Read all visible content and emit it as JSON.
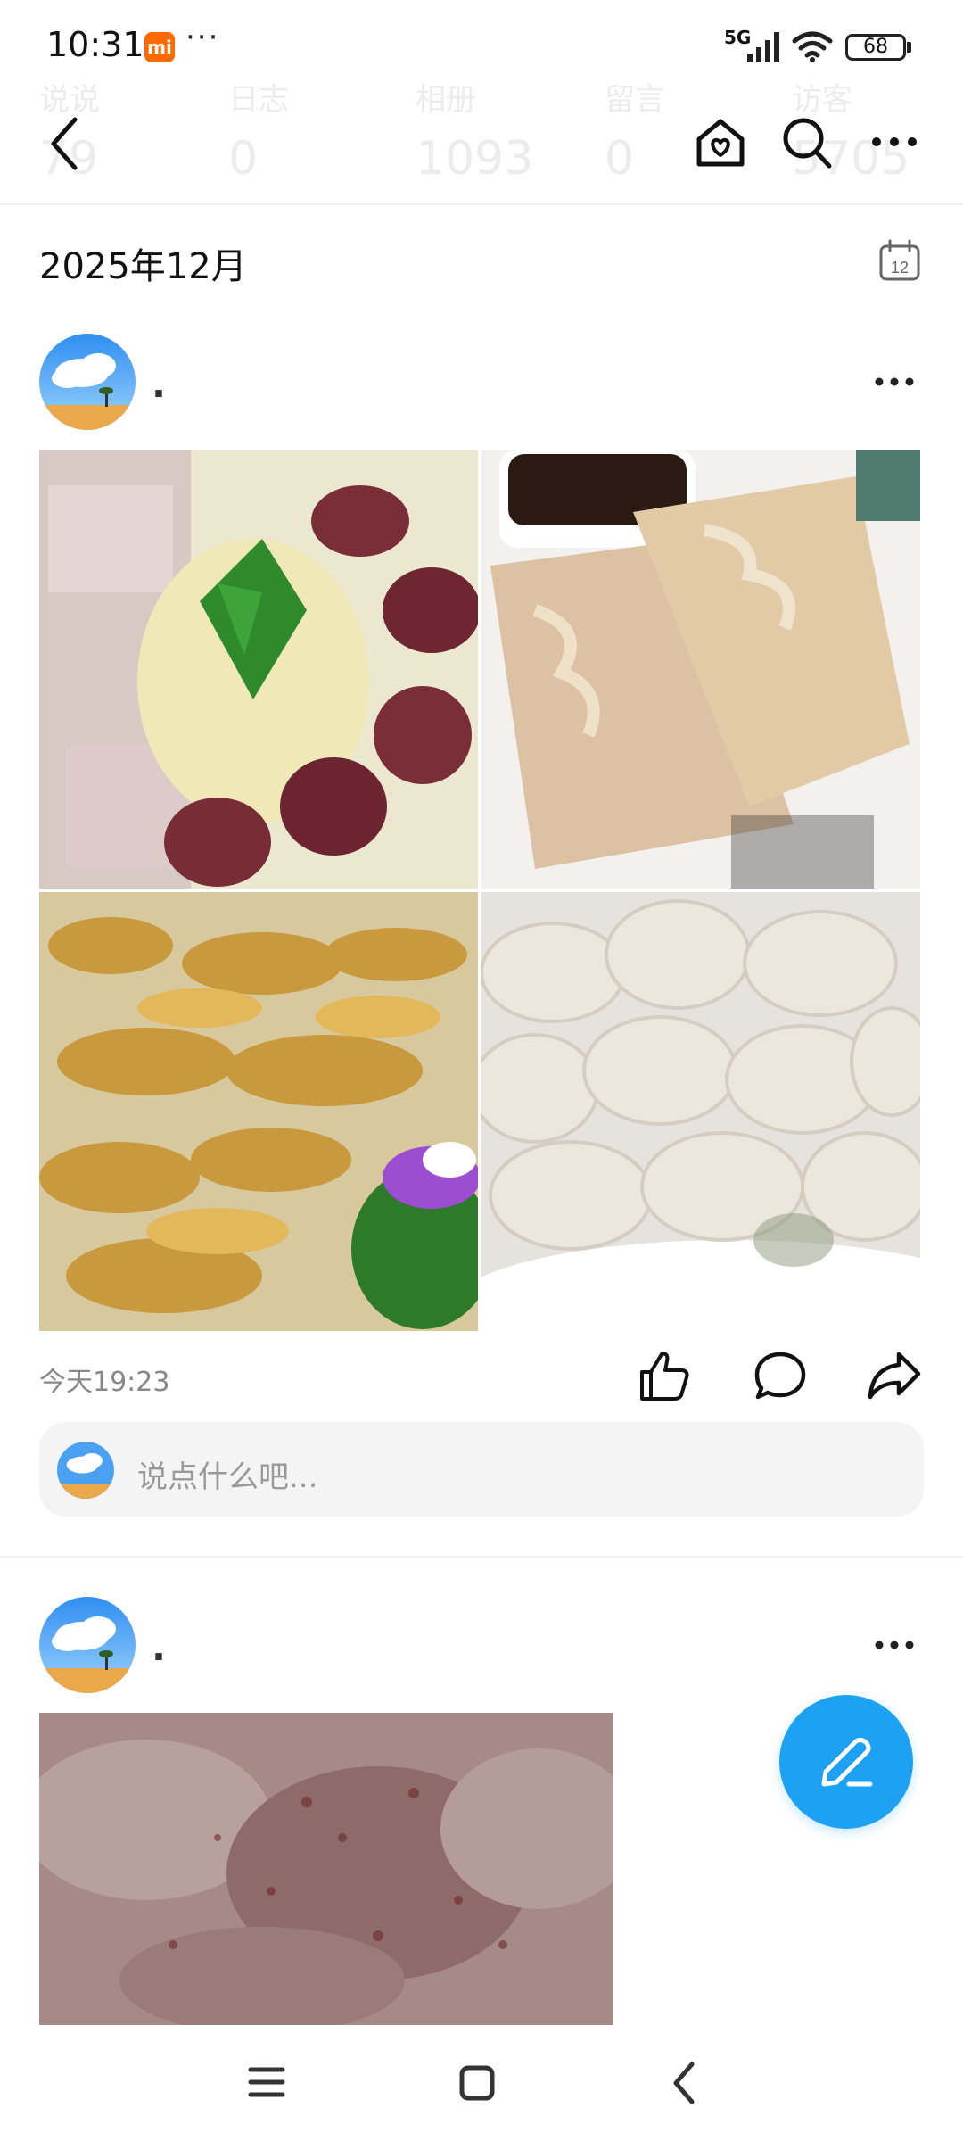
{
  "status_bar": {
    "time": "10:31",
    "carrier_badge": "mi",
    "dots": "···",
    "network": "5G",
    "battery": "68"
  },
  "stats": [
    {
      "label": "说说",
      "value": "79"
    },
    {
      "label": "日志",
      "value": "0"
    },
    {
      "label": "相册",
      "value": "1093"
    },
    {
      "label": "留言",
      "value": "0"
    },
    {
      "label": "访客",
      "value": "5705"
    }
  ],
  "nav": {
    "back_icon": "chevron-left-icon",
    "heart_home_icon": "heart-home-icon",
    "search_icon": "search-icon",
    "more_icon": "more-icon"
  },
  "section": {
    "month": "2025年12月",
    "calendar_day": "12"
  },
  "posts": [
    {
      "name": ".",
      "time": "今天19:23",
      "photos": [
        "blood-sausage-sauerkraut",
        "steamed-crystal-dumplings",
        "fried-pork-strips",
        "boiled-dumplings"
      ]
    },
    {
      "name": ".",
      "photos": [
        "spicy-soup-closeup"
      ]
    }
  ],
  "comment": {
    "placeholder": "说点什么吧..."
  },
  "colors": {
    "accent": "#1da1f2",
    "mi_orange": "#ff6a00"
  }
}
